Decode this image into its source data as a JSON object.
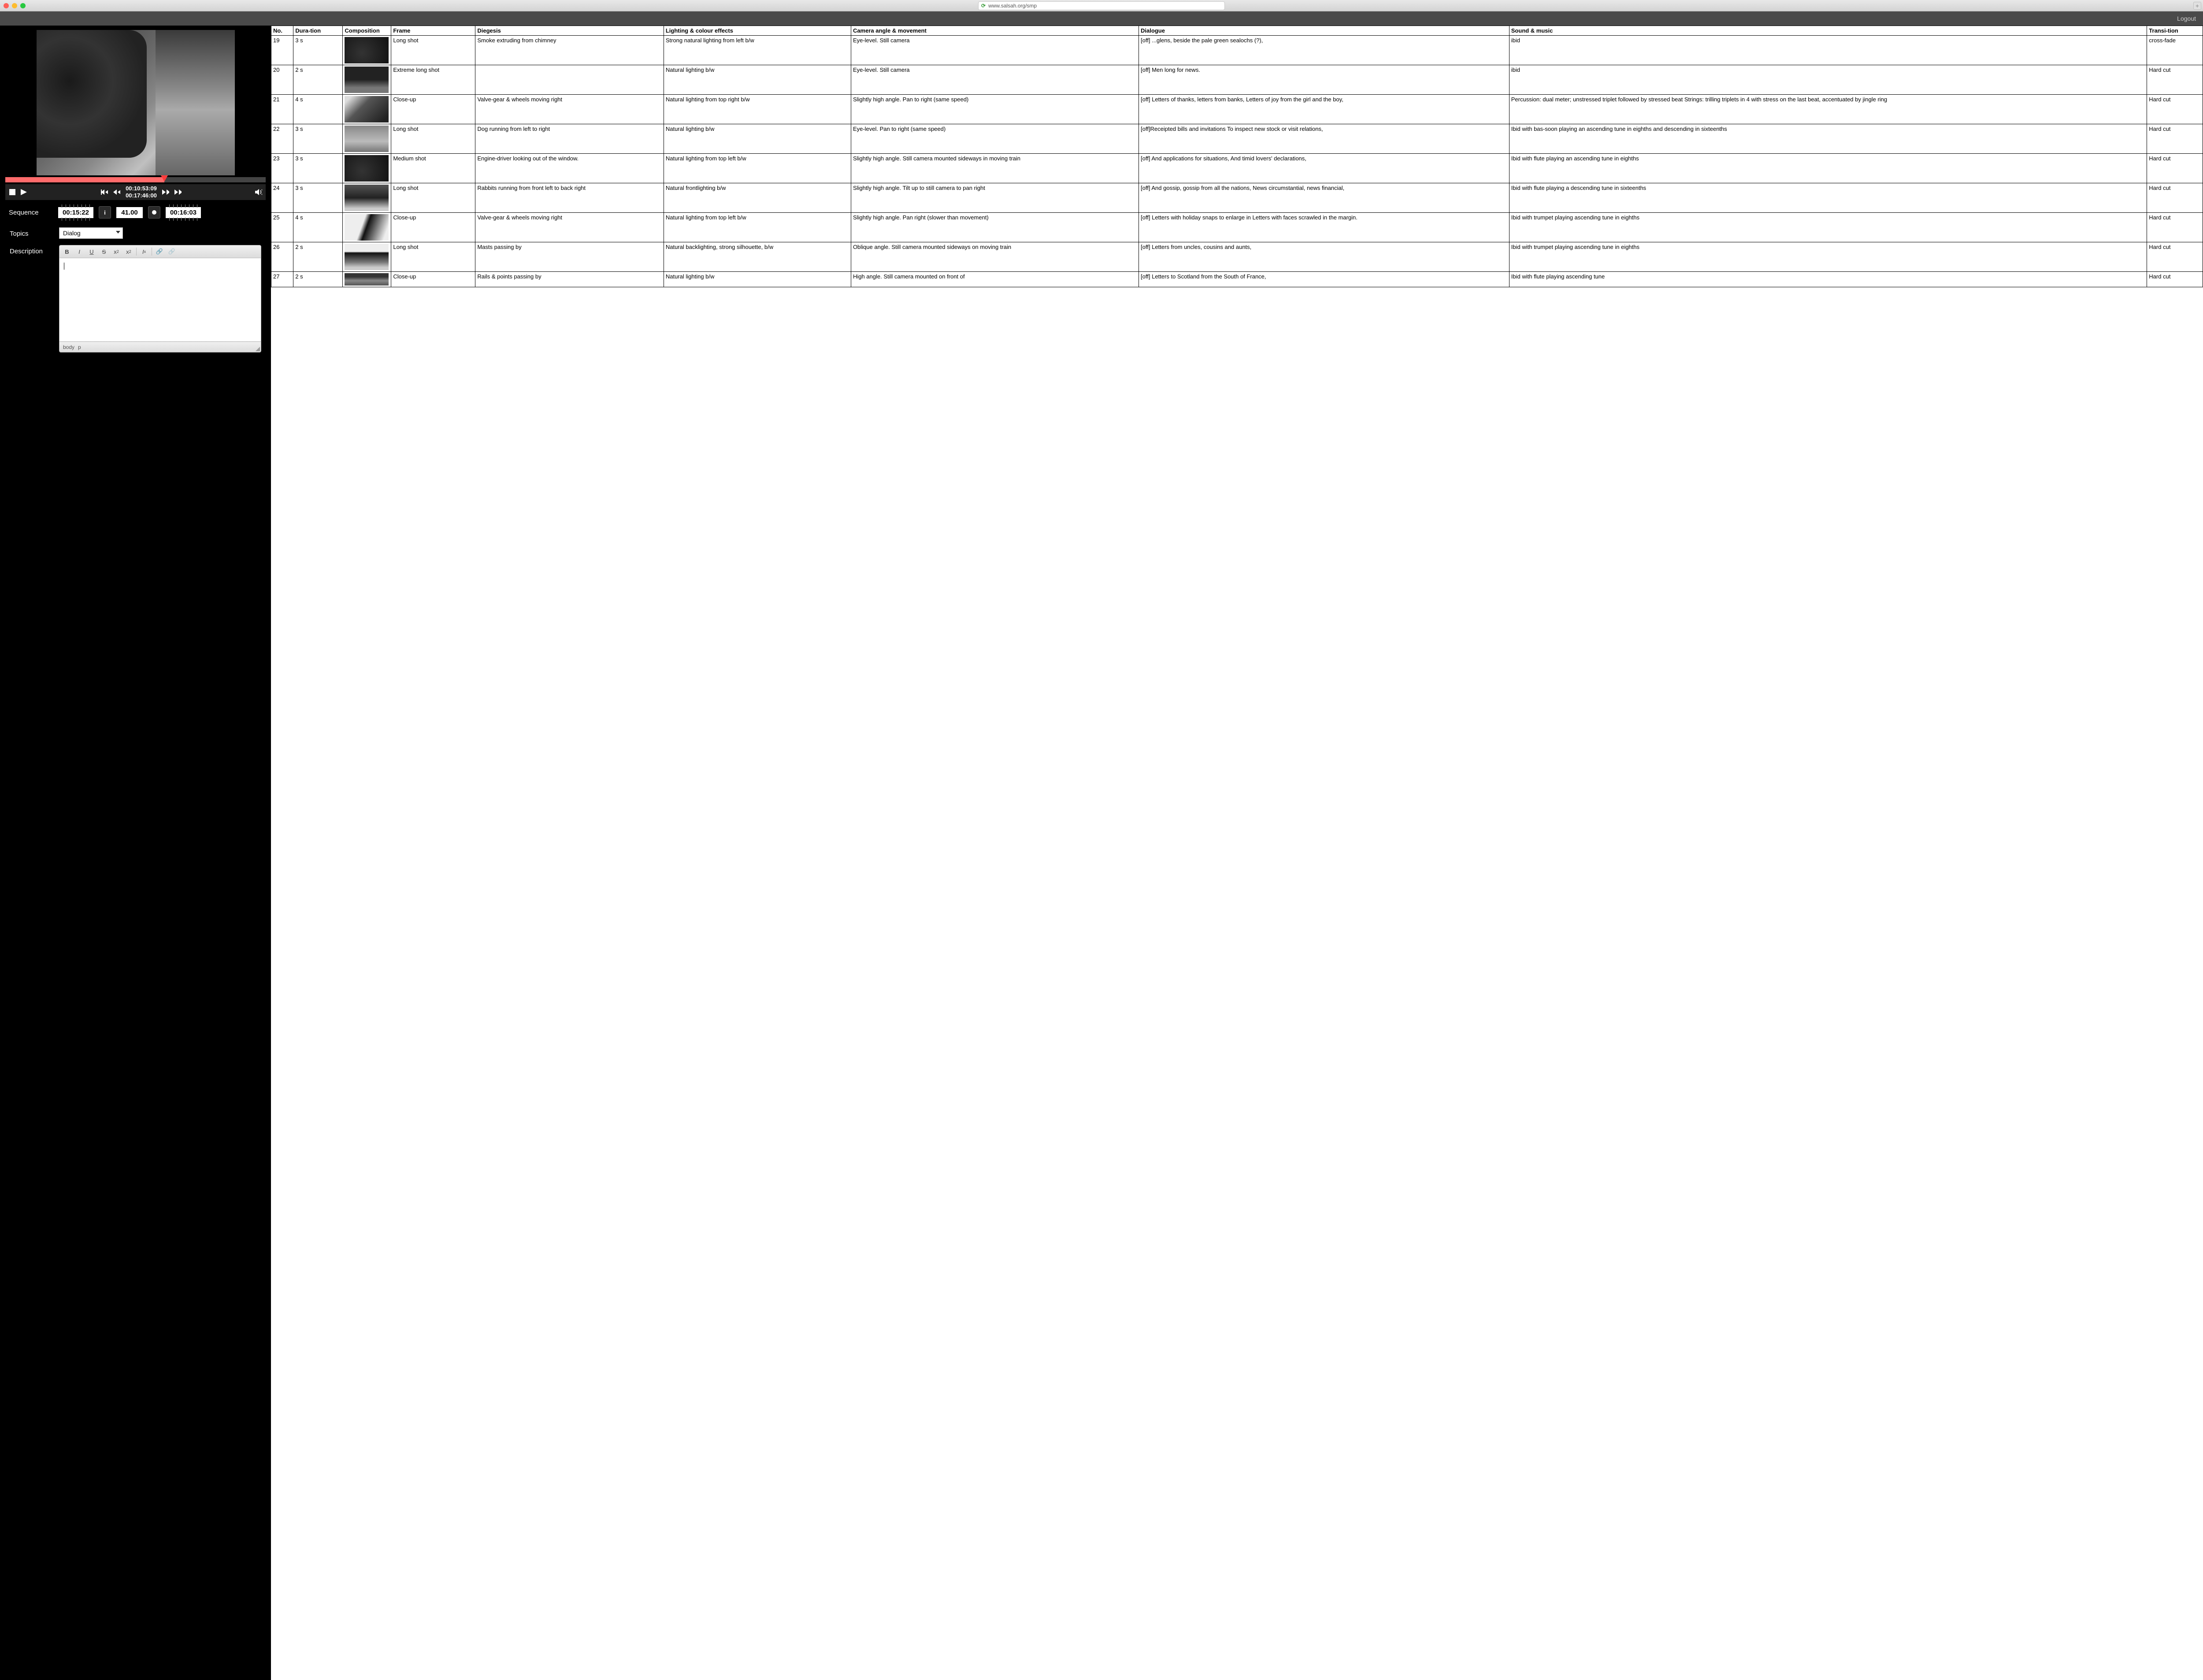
{
  "browser": {
    "url": "www.salsah.org/smp",
    "newtab": "+"
  },
  "toolbar": {
    "logout": "Logout"
  },
  "player": {
    "current_time": "00:10:53:09",
    "total_time": "00:17:46:00"
  },
  "sequence": {
    "label": "Sequence",
    "start_tc": "00:15:22",
    "number": "41.00",
    "end_tc": "00:16:03"
  },
  "topics": {
    "label": "Topics",
    "selected": "Dialog"
  },
  "description": {
    "label": "Description",
    "status_body": "body",
    "status_p": "p"
  },
  "table": {
    "headers": {
      "no": "No.",
      "duration": "Dura-tion",
      "composition": "Composition",
      "frame": "Frame",
      "diegesis": "Diegesis",
      "lighting": "Lighting & colour effects",
      "camera": "Camera angle & movement",
      "dialogue": "Dialogue",
      "sound": "Sound & music",
      "transition": "Transi-tion"
    },
    "rows": [
      {
        "no": "19",
        "dur": "3 s",
        "frame": "Long shot",
        "dieg": "Smoke extruding from chimney",
        "light": "Strong natural lighting from left b/w",
        "cam": "Eye-level. Still camera",
        "dial": "[off] ...glens, beside the pale green sealochs (?),",
        "sound": "ibid",
        "trans": "cross-fade",
        "thumb": "t3",
        "partial": true
      },
      {
        "no": "20",
        "dur": "2 s",
        "frame": "Extreme long shot",
        "dieg": "",
        "light": "Natural lighting b/w",
        "cam": "Eye-level. Still camera",
        "dial": "[off] Men long for news.",
        "sound": "ibid",
        "trans": "Hard cut",
        "thumb": "t2"
      },
      {
        "no": "21",
        "dur": "4 s",
        "frame": "Close-up",
        "dieg": "Valve-gear & wheels moving right",
        "light": "Natural lighting from top right b/w",
        "cam": "Slightly high angle. Pan to right (same speed)",
        "dial": "[off] Letters of thanks, letters from banks, Letters of joy from the girl and the boy,",
        "sound": "Percussion:  dual meter; unstressed triplet followed by stressed beat Strings: trilling triplets in 4 with stress on the last beat, accentuated by jingle ring",
        "trans": "Hard cut",
        "thumb": "t4"
      },
      {
        "no": "22",
        "dur": "3 s",
        "frame": "Long shot",
        "dieg": "Dog running from left to right",
        "light": "Natural lighting b/w",
        "cam": "Eye-level. Pan to right (same speed)",
        "dial": "[off]Receipted bills and invitations To inspect new stock or visit relations,",
        "sound": "Ibid with bas-soon playing an ascending tune in eighths and descending in sixteenths",
        "trans": "Hard cut",
        "thumb": "t5"
      },
      {
        "no": "23",
        "dur": "3 s",
        "frame": "Medium shot",
        "dieg": "Engine-driver looking out of the window.",
        "light": "Natural lighting from top left b/w",
        "cam": "Slightly high angle. Still camera mounted sideways in moving train",
        "dial": "[off] And applications for situations,   And timid lovers' declarations,",
        "sound": "Ibid with flute playing an ascending tune in eighths",
        "trans": "Hard cut",
        "thumb": "t3"
      },
      {
        "no": "24",
        "dur": "3 s",
        "frame": "Long shot",
        "dieg": "Rabbits running from front left to back right",
        "light": "Natural frontlighting b/w",
        "cam": "Slightly high angle. Tilt up to still camera to pan right",
        "dial": "[off] And gossip, gossip from all the nations, News circumstantial, news financial,",
        "sound": "Ibid with flute playing a descending tune in sixteenths",
        "trans": "Hard cut",
        "thumb": "t6"
      },
      {
        "no": "25",
        "dur": "4 s",
        "frame": "Close-up",
        "dieg": "Valve-gear & wheels moving right",
        "light": "Natural lighting from top left b/w",
        "cam": "Slightly high angle. Pan right (slower than movement)",
        "dial": "[off] Letters  with holiday snaps to enlarge in Letters with faces scrawled in the margin.",
        "sound": "Ibid with trumpet playing ascending tune in eighths",
        "trans": "Hard cut",
        "thumb": "t7"
      },
      {
        "no": "26",
        "dur": "2 s",
        "frame": "Long shot",
        "dieg": "Masts passing by",
        "light": "Natural backlighting, strong silhouette, b/w",
        "cam": "Oblique angle. Still camera mounted sideways on moving train",
        "dial": "[off] Letters from uncles, cousins and aunts,",
        "sound": "Ibid with trumpet playing ascending tune in eighths",
        "trans": "Hard cut",
        "thumb": "t8"
      },
      {
        "no": "27",
        "dur": "2 s",
        "frame": "Close-up",
        "dieg": "Rails & points passing by",
        "light": "Natural lighting b/w",
        "cam": "High angle. Still camera mounted on front of",
        "dial": "[off] Letters to Scotland from the South of France,",
        "sound": "Ibid with flute playing ascending tune",
        "trans": "Hard cut",
        "thumb": "t9",
        "bottompartial": true
      }
    ]
  }
}
